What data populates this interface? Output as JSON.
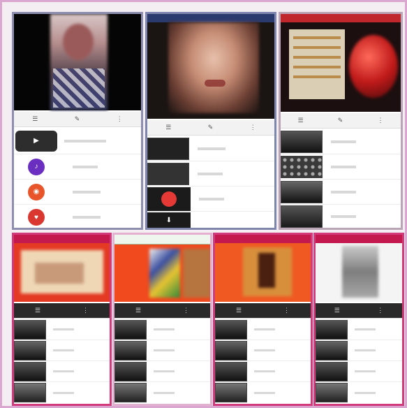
{
  "tiles": [
    {
      "rows": [
        {
          "icon": "play-icon",
          "color": "#2d2d2d"
        },
        {
          "icon": "music-icon",
          "color": "#6a2fc0"
        },
        {
          "icon": "camera-icon",
          "color": "#e8552a"
        },
        {
          "icon": "heart-icon",
          "color": "#d9372f"
        }
      ]
    },
    {
      "rows": [
        {
          "icon": "photo-thumb",
          "color": "#222222"
        },
        {
          "icon": "photo-thumb",
          "color": "#333333"
        },
        {
          "icon": "record-icon",
          "color": "#e53935"
        },
        {
          "icon": "download-icon",
          "color": "#1b1b1b"
        }
      ]
    },
    {
      "rows": [
        {
          "icon": "photo-thumb",
          "color": "#2a2a2a"
        },
        {
          "icon": "grid-icon",
          "color": "#3a3a3a"
        },
        {
          "icon": "photo-thumb",
          "color": "#2a2a2a"
        },
        {
          "icon": "photo-thumb",
          "color": "#2a2a2a"
        }
      ]
    }
  ],
  "bottom_tiles": [
    {
      "hero_color": "#e43a23",
      "accent": "#c4194f"
    },
    {
      "hero_color": "#f04a1e",
      "accent": "#c4194f"
    },
    {
      "hero_color": "#f05a22",
      "accent": "#c4194f"
    },
    {
      "hero_color": "#f4f4f4",
      "accent": "#c4194f"
    }
  ],
  "colors": {
    "frame": "#d9a7cf",
    "accent_pink": "#d23a7c",
    "appbar": "#f2f2f2"
  }
}
